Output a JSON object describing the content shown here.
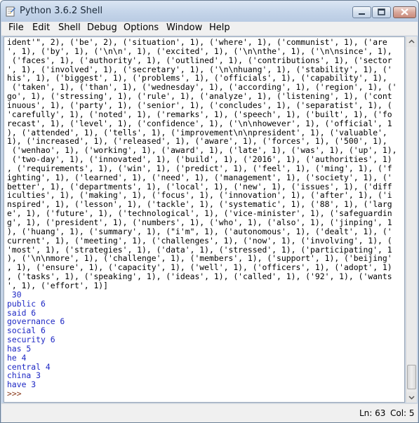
{
  "window": {
    "title": "Python 3.6.2 Shell"
  },
  "menu": [
    "File",
    "Edit",
    "Shell",
    "Debug",
    "Options",
    "Window",
    "Help"
  ],
  "data_lines": [
    "ident'\", 2), ('be', 2), ('situation', 1), ('where', 1), ('communist', 1), ('are",
    "', 1), ('by', 1), ('\\n\\n', 1), ('excited', 1), ('\\n\\nthe', 1), ('\\n\\nsince', 1),",
    " ('faces', 1), ('authority', 1), ('outlined', 1), ('contributions', 1), ('sector",
    "', 1), ('involved', 1), ('secretary', 1), ('\\n\\nhuang', 1), ('stability', 1), ('",
    "his', 1), ('biggest', 1), ('problems', 1), ('officials', 1), ('capability', 1),",
    " ('taken', 1), ('than', 1), ('wednesday', 1), ('according', 1), ('region', 1), ('",
    "go', 1), ('stressing', 1), ('rule', 1), ('analyze', 1), ('listening', 1), ('cont",
    "inuous', 1), ('party', 1), ('senior', 1), ('concludes', 1), ('separatist', 1), (",
    "'carefully', 1), ('noted', 1), ('remarks', 1), ('speech', 1), ('built', 1), ('fo",
    "recast', 1), ('level', 1), ('confidence', 1), ('\\n\\nhowever', 1), ('official', 1",
    "), ('attended', 1), ('tells', 1), ('improvement\\n\\npresident', 1), ('valuable',",
    "1), ('increased', 1), ('released', 1), ('aware', 1), ('forces', 1), ('500', 1),",
    " ('wenhao', 1), ('working', 1), ('award', 1), ('late', 1), ('was', 1), ('up', 1),",
    " ('two-day', 1), ('innovated', 1), ('build', 1), ('2016', 1), ('authorities', 1)",
    ", ('requirements', 1), ('win', 1), ('predict', 1), ('feel', 1), ('ming', 1), ('f",
    "ighting', 1), ('learned', 1), ('need', 1), ('management', 1), ('society', 1), ('",
    "better', 1), ('departments', 1), ('local', 1), ('new', 1), ('issues', 1), ('diff",
    "iculties', 1), ('making', 1), ('focus', 1), ('innovation', 1), ('after', 1), ('i",
    "nspired', 1), ('lesson', 1), ('tackle', 1), ('systematic', 1), ('88', 1), ('larg",
    "e', 1), ('future', 1), ('technological', 1), ('vice-minister', 1), ('safeguardin",
    "g', 1), ('president', 1), ('numbers', 1), ('who', 1), ('also', 1), ('jinping', 1",
    "), ('huang', 1), ('summary', 1), (\"i'm\", 1), ('autonomous', 1), ('dealt', 1), ('",
    "current', 1), ('meeting', 1), ('challenges', 1), ('now', 1), ('involving', 1), (",
    "'most', 1), ('strategies', 1), ('data', 1), ('stressed', 1), ('participating', 1",
    "), ('\\n\\nmore', 1), ('challenge', 1), ('members', 1), ('support', 1), ('beijing'",
    ", 1), ('ensure', 1), ('capacity', 1), ('well', 1), ('officers', 1), ('adopt', 1)",
    ", ('tasks', 1), ('speaking', 1), ('ideas', 1), ('called', 1), ('92', 1), ('wants",
    "', 1), ('effort', 1)]"
  ],
  "output_lines": [
    " 30",
    "public 6",
    "said 6",
    "governance 6",
    "social 6",
    "security 6",
    "has 5",
    "he 4",
    "central 4",
    "china 3",
    "have 3"
  ],
  "prompt": ">>> ",
  "status": {
    "line": "Ln: 63",
    "col": "Col: 5"
  },
  "colors": {
    "output": "#1d27c4",
    "prompt": "#8a3b1c",
    "text": "#000000"
  }
}
